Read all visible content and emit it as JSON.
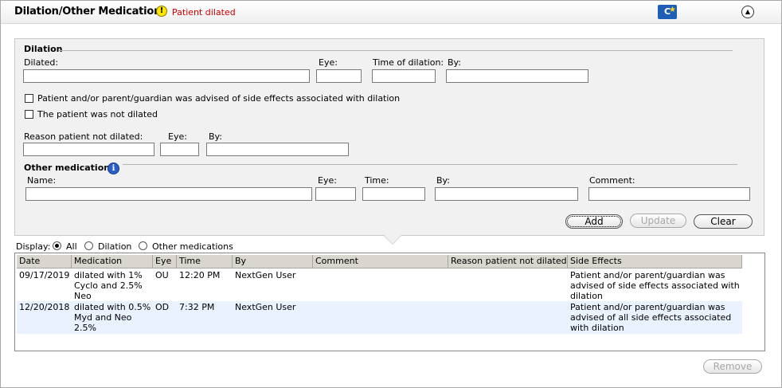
{
  "header": {
    "title": "Dilation/Other Medications",
    "status_text": "Patient dilated",
    "ce_icon_text": "C"
  },
  "dilation": {
    "section_label": "Dilation",
    "dilated_label": "Dilated:",
    "eye_label": "Eye:",
    "time_label": "Time of dilation:",
    "by_label": "By:",
    "advised_checkbox_label": "Patient and/or parent/guardian was advised of side effects associated with dilation",
    "not_dilated_checkbox_label": "The patient was not dilated",
    "reason_label": "Reason patient not dilated:",
    "reason_eye_label": "Eye:",
    "reason_by_label": "By:"
  },
  "other_meds": {
    "section_label": "Other medications",
    "name_label": "Name:",
    "eye_label": "Eye:",
    "time_label": "Time:",
    "by_label": "By:",
    "comment_label": "Comment:"
  },
  "buttons": {
    "add": "Add",
    "update": "Update",
    "clear": "Clear",
    "remove": "Remove"
  },
  "display": {
    "label": "Display:",
    "options": [
      "All",
      "Dilation",
      "Other medications"
    ],
    "selected": "All"
  },
  "table": {
    "columns": [
      "Date",
      "Medication",
      "Eye",
      "Time",
      "By",
      "Comment",
      "Reason patient not dilated",
      "Side Effects"
    ],
    "rows": [
      {
        "date": "09/17/2019",
        "medication": "dilated with 1% Cyclo and 2.5% Neo",
        "eye": "OU",
        "time": "12:20 PM",
        "by": "NextGen User",
        "comment": "",
        "reason": "",
        "side_effects": "Patient and/or parent/guardian was advised of side effects associated with dilation"
      },
      {
        "date": "12/20/2018",
        "medication": "dilated with 0.5% Myd and Neo 2.5%",
        "eye": "OD",
        "time": "7:32 PM",
        "by": "NextGen User",
        "comment": "",
        "reason": "",
        "side_effects": "Patient and/or parent/guardian was advised of all side effects associated with dilation"
      }
    ]
  },
  "colors": {
    "status_red": "#d00000",
    "row_alt": "#eaf2ff",
    "header_bg": "#d9d6d0",
    "ce_icon_blue": "#1e5fb4"
  },
  "icons": {
    "status": "warning-icon",
    "ce": "clinical-education-icon",
    "collapse": "collapse-up-icon",
    "info": "info-icon"
  }
}
